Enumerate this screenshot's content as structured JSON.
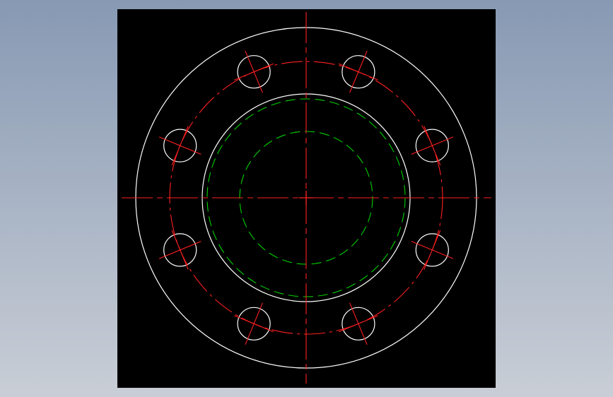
{
  "colors": {
    "background_top": "#8799b3",
    "background_bottom": "#c9ced6",
    "canvas": "#000000",
    "geometry": "#ffffff",
    "centerlines": "#ff2020",
    "hidden_lines": "#00d000"
  },
  "drawing": {
    "part": "flange",
    "bolt_hole_count": 8,
    "bolt_hole_angles_deg": [
      22.5,
      67.5,
      112.5,
      157.5,
      202.5,
      247.5,
      292.5,
      337.5
    ]
  }
}
